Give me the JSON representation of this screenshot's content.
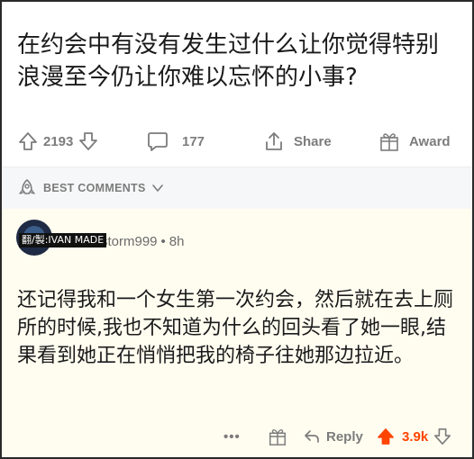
{
  "post": {
    "title": "在约会中有没有发生过什么让你觉得特别浪漫至今仍让你难以忘怀的小事?",
    "upvotes": "2193",
    "comments": "177",
    "share_label": "Share",
    "award_label": "Award"
  },
  "sort": {
    "label": "BEST COMMENTS"
  },
  "comment": {
    "watermark": "翻/製:IVAN MADE",
    "username": "storm999",
    "separator": "•",
    "age": "8h",
    "body": "还记得我和一个女生第一次约会，然后就在去上厕所的时候,我也不知道为什么的回头看了她一眼,结果看到她正在悄悄把我的椅子往她那边拉近。",
    "more_label": "•••",
    "reply_label": "Reply",
    "score": "3.9k"
  },
  "colors": {
    "accent_upvote": "#ff4500",
    "icon_gray": "#7c7c7c",
    "comment_bg": "#fffdf0"
  }
}
